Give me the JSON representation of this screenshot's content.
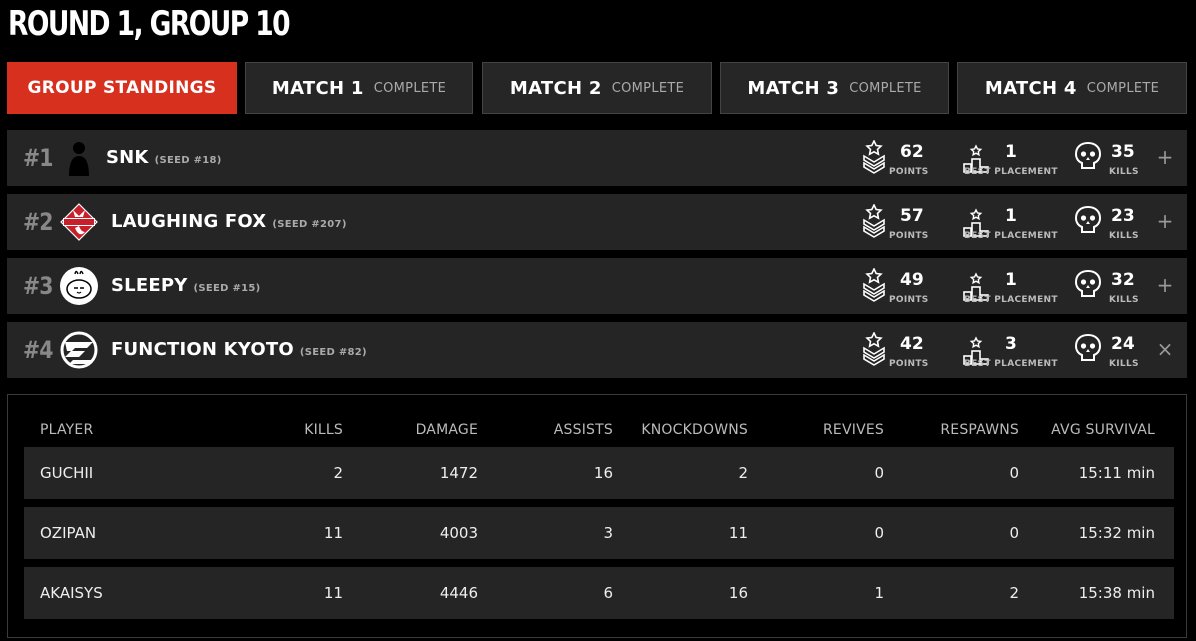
{
  "page_title": "ROUND 1, GROUP 10",
  "tabs": [
    {
      "label": "GROUP STANDINGS",
      "status": ""
    },
    {
      "label": "MATCH 1",
      "status": "COMPLETE"
    },
    {
      "label": "MATCH 2",
      "status": "COMPLETE"
    },
    {
      "label": "MATCH 3",
      "status": "COMPLETE"
    },
    {
      "label": "MATCH 4",
      "status": "COMPLETE"
    }
  ],
  "stat_labels": {
    "points": "POINTS",
    "placement": "BEST PLACEMENT",
    "kills": "KILLS"
  },
  "teams": [
    {
      "rank": "#1",
      "name": "SNK",
      "seed": "(SEED #18)",
      "points": "62",
      "placement": "1",
      "kills": "35",
      "toggle": "+"
    },
    {
      "rank": "#2",
      "name": "LAUGHING FOX",
      "seed": "(SEED #207)",
      "points": "57",
      "placement": "1",
      "kills": "23",
      "toggle": "+"
    },
    {
      "rank": "#3",
      "name": "SLEEPY",
      "seed": "(SEED #15)",
      "points": "49",
      "placement": "1",
      "kills": "32",
      "toggle": "+"
    },
    {
      "rank": "#4",
      "name": "FUNCTION KYOTO",
      "seed": "(SEED #82)",
      "points": "42",
      "placement": "3",
      "kills": "24",
      "toggle": "×"
    }
  ],
  "player_table": {
    "headers": [
      "PLAYER",
      "KILLS",
      "DAMAGE",
      "ASSISTS",
      "KNOCKDOWNS",
      "REVIVES",
      "RESPAWNS",
      "AVG SURVIVAL"
    ],
    "rows": [
      [
        "GUCHII",
        "2",
        "1472",
        "16",
        "2",
        "0",
        "0",
        "15:11 min"
      ],
      [
        "OZIPAN",
        "11",
        "4003",
        "3",
        "11",
        "0",
        "0",
        "15:32 min"
      ],
      [
        "AKAISYS",
        "11",
        "4446",
        "6",
        "16",
        "1",
        "2",
        "15:38 min"
      ]
    ]
  },
  "colors": {
    "accent": "#d7301f",
    "row_bg": "#252525",
    "page_bg": "#000000"
  }
}
